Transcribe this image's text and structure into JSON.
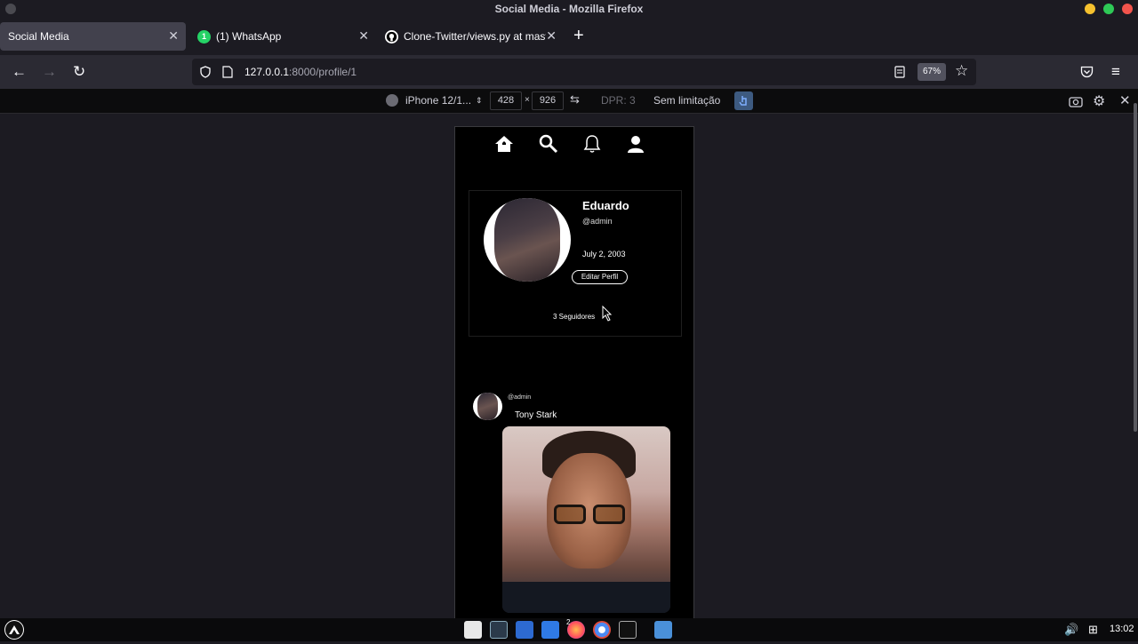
{
  "window": {
    "title": "Social Media - Mozilla Firefox"
  },
  "tabs": [
    {
      "label": "Social Media",
      "active": true
    },
    {
      "label": "(1) WhatsApp",
      "badge": "1",
      "active": false
    },
    {
      "label": "Clone-Twitter/views.py at maste",
      "active": false
    }
  ],
  "nav": {
    "url_host": "127.0.0.1",
    "url_rest": ":8000/profile/1",
    "zoom": "67%"
  },
  "rdm": {
    "device": "iPhone 12/1...",
    "width": "428",
    "times": "×",
    "height": "926",
    "dpr": "DPR: 3",
    "throttle": "Sem limitação"
  },
  "profile": {
    "name": "Eduardo",
    "handle": "@admin",
    "birth_date": "July 2, 2003",
    "edit_label": "Editar Perfil",
    "followers": "3 Seguidores"
  },
  "post": {
    "handle": "@admin",
    "text": "Tony Stark"
  },
  "taskbar": {
    "clock": "13:02",
    "firefox_badge": "2"
  },
  "colors": {
    "accent_blue": "#3d5a80",
    "whatsapp_green": "#25d366"
  }
}
